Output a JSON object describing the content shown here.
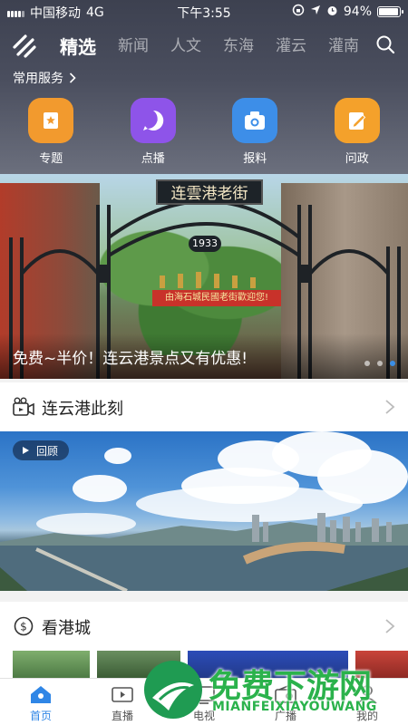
{
  "status_bar": {
    "carrier": "中国移动",
    "network": "4G",
    "time": "下午3:55",
    "battery_text": "94%",
    "battery_level": 0.94
  },
  "nav": {
    "tabs": [
      {
        "label": "精选",
        "active": true
      },
      {
        "label": "新闻"
      },
      {
        "label": "人文"
      },
      {
        "label": "东海"
      },
      {
        "label": "灌云"
      },
      {
        "label": "灌南"
      }
    ]
  },
  "services": {
    "title": "常用服务",
    "items": [
      {
        "label": "专题",
        "icon": "topic-icon",
        "color": "#f29a2e"
      },
      {
        "label": "点播",
        "icon": "play-icon",
        "color": "#8e54e9"
      },
      {
        "label": "报料",
        "icon": "camera-icon",
        "color": "#3d8ee8"
      },
      {
        "label": "问政",
        "icon": "edit-icon",
        "color": "#f4a12b"
      }
    ]
  },
  "banner": {
    "caption": "免费~半价！连云港景点又有优惠!",
    "gate_sign": "连雲港老街",
    "year_sign": "1933",
    "red_banner": "由海石城民國老街歡迎您!",
    "dots": 3,
    "active_dot": 2
  },
  "section_now": {
    "title": "连云港此刻"
  },
  "video": {
    "replay_label": "回顾"
  },
  "section_city": {
    "title": "看港城"
  },
  "bottom_tabs": [
    {
      "label": "首页",
      "icon": "home-icon",
      "active": true
    },
    {
      "label": "直播",
      "icon": "live-icon"
    },
    {
      "label": "电视",
      "icon": "tv-icon"
    },
    {
      "label": "广播",
      "icon": "radio-icon"
    },
    {
      "label": "我的",
      "icon": "user-icon"
    }
  ],
  "watermark": {
    "text": "免费下游网",
    "url": "MIANFEIXIAYOUWANG"
  },
  "colors": {
    "accent": "#2f86e6",
    "header_bg": "#44485a",
    "watermark_green": "#2bb24c"
  }
}
